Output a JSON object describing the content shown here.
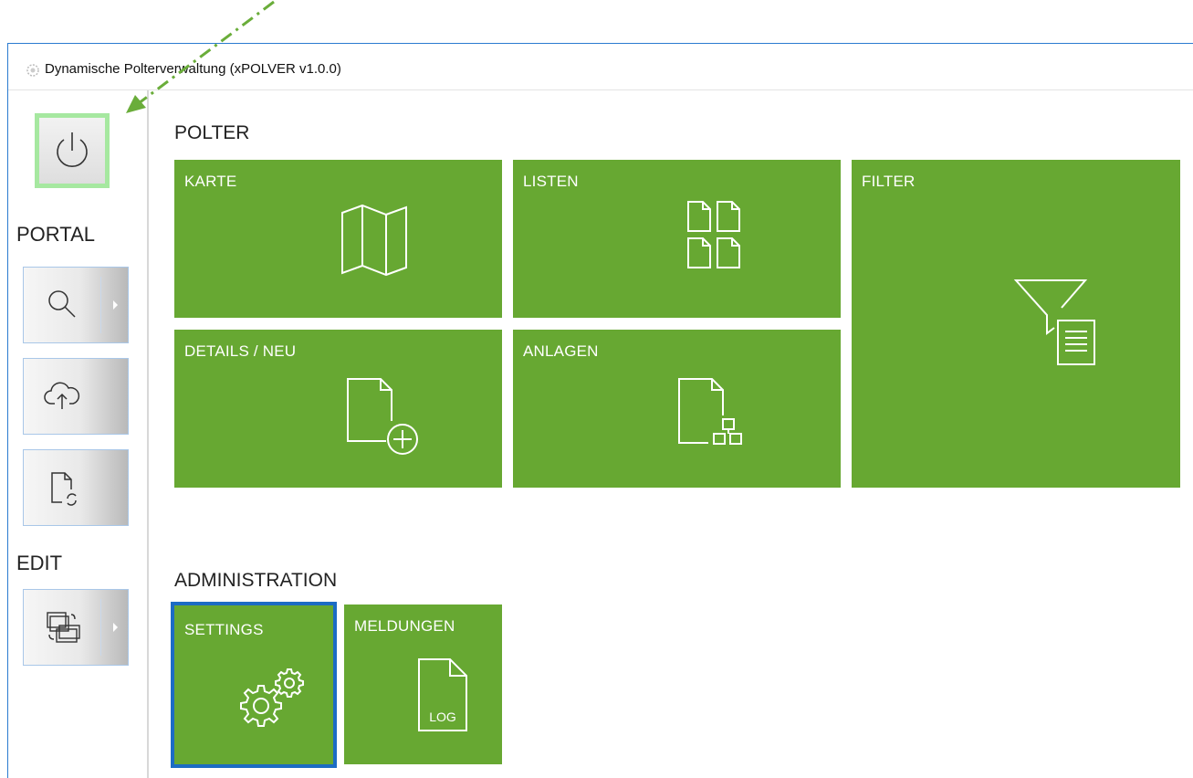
{
  "window": {
    "title": "Dynamische Polterverwaltung (xPOLVER v1.0.0)"
  },
  "sidebar": {
    "power_icon": "power-icon",
    "portal_label": "PORTAL",
    "edit_label": "EDIT",
    "buttons": [
      {
        "icon": "search-icon",
        "has_dropdown": true
      },
      {
        "icon": "cloud-upload-icon",
        "has_dropdown": false
      },
      {
        "icon": "document-refresh-icon",
        "has_dropdown": false
      },
      {
        "icon": "folder-sync-icon",
        "has_dropdown": true
      }
    ]
  },
  "main": {
    "polter_title": "POLTER",
    "admin_title": "ADMINISTRATION",
    "tiles": {
      "karte": {
        "label": "KARTE",
        "icon": "map-icon"
      },
      "listen": {
        "label": "LISTEN",
        "icon": "documents-grid-icon"
      },
      "filter": {
        "label": "FILTER",
        "icon": "filter-list-icon"
      },
      "details": {
        "label": "DETAILS / NEU",
        "icon": "document-add-icon"
      },
      "anlagen": {
        "label": "ANLAGEN",
        "icon": "document-attachments-icon"
      },
      "settings": {
        "label": "SETTINGS",
        "icon": "gears-icon"
      },
      "meldungen": {
        "label": "MELDUNGEN",
        "icon": "log-file-icon",
        "icon_text": "LOG"
      }
    }
  },
  "colors": {
    "tile_green": "#67a832",
    "selection_blue": "#1c6cc4",
    "power_highlight": "#a6e8a0",
    "guide_arrow": "#6aad3a"
  }
}
